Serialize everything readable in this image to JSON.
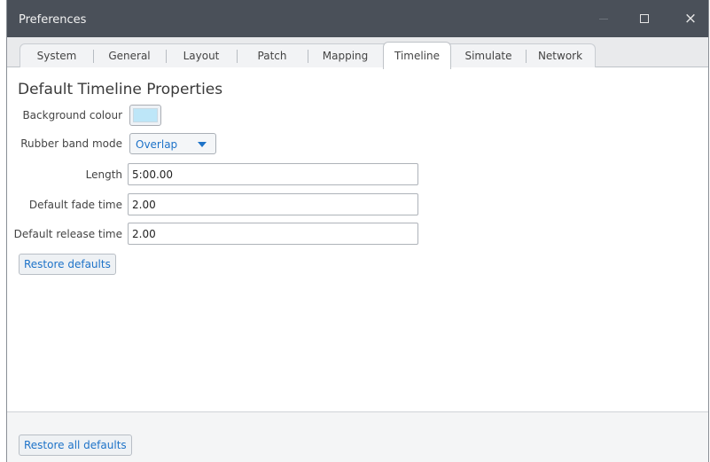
{
  "window": {
    "title": "Preferences",
    "controls": {
      "minimize": "minimize-icon",
      "maximize": "maximize-icon",
      "close": "×"
    }
  },
  "tabs": [
    {
      "label": "System"
    },
    {
      "label": "General"
    },
    {
      "label": "Layout"
    },
    {
      "label": "Patch"
    },
    {
      "label": "Mapping"
    },
    {
      "label": "Timeline"
    },
    {
      "label": "Simulate"
    },
    {
      "label": "Network"
    }
  ],
  "active_tab": "Timeline",
  "section": {
    "title": "Default Timeline Properties",
    "background_colour": {
      "label": "Background colour",
      "value": "#bde6f8"
    },
    "rubber_band_mode": {
      "label": "Rubber band mode",
      "value": "Overlap"
    },
    "length": {
      "label": "Length",
      "value": "5:00.00"
    },
    "fade_time": {
      "label": "Default fade time",
      "value": "2.00"
    },
    "release_time": {
      "label": "Default release time",
      "value": "2.00"
    },
    "restore_defaults": "Restore defaults"
  },
  "footer": {
    "restore_all_defaults": "Restore all defaults"
  },
  "colors": {
    "titlebar": "#4a5059",
    "accent": "#1e73c8"
  }
}
